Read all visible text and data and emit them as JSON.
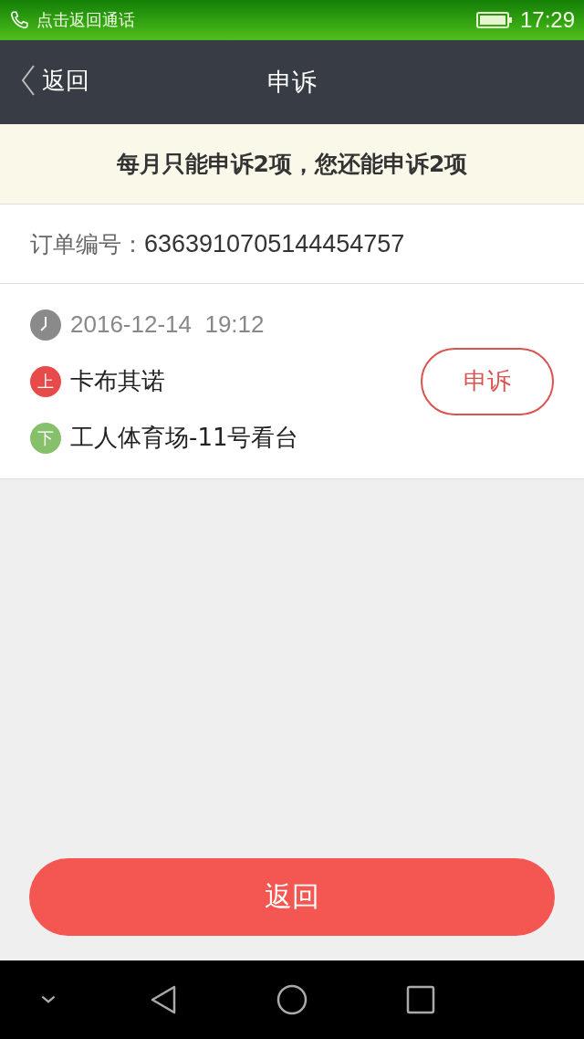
{
  "status_bar": {
    "call_hint": "点击返回通话",
    "time": "17:29"
  },
  "nav": {
    "back": "返回",
    "title": "申诉"
  },
  "notice": "每月只能申诉2项，您还能申诉2项",
  "order": {
    "label": "订单编号：",
    "number": "6363910705144454757"
  },
  "trip": {
    "datetime": "2016-12-14  19:12",
    "appeal_button": "申诉",
    "stops": [
      {
        "badge": "上",
        "name": "卡布其诺",
        "color": "#e84a4a"
      },
      {
        "badge": "下",
        "name": "工人体育场-11号看台",
        "color": "#86c06a"
      }
    ]
  },
  "bottom_button": "返回"
}
